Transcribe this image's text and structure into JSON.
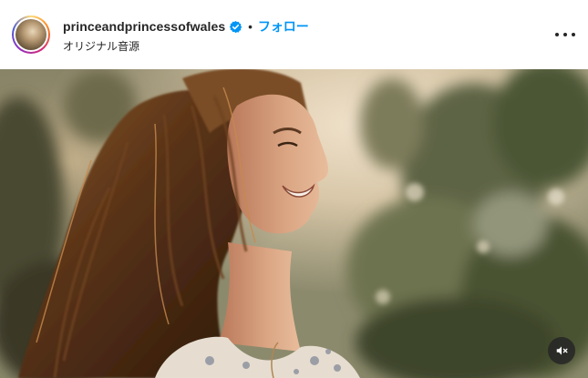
{
  "post": {
    "username": "princeandprincessofwales",
    "separator": "•",
    "follow_label": "フォロー",
    "audio_label": "オリジナル音源"
  },
  "icons": {
    "verified": "verified-badge-icon",
    "more": "more-options-icon",
    "mute": "audio-muted-icon"
  },
  "colors": {
    "follow_blue": "#0095f6",
    "verified_blue": "#0095f6",
    "text": "#262626"
  }
}
